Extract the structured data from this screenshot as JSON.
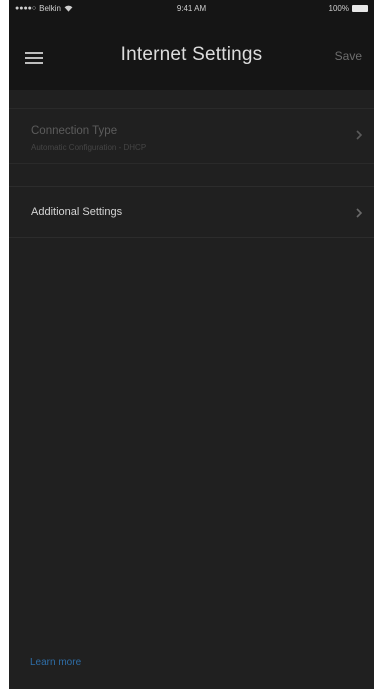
{
  "status_bar": {
    "carrier": "Belkin",
    "time": "9:41 AM",
    "battery": "100%"
  },
  "header": {
    "title": "Internet Settings",
    "save_label": "Save",
    "menu_icon": "hamburger-menu-icon"
  },
  "settings": {
    "connection_type": {
      "label": "Connection Type",
      "value": "Automatic Configuration - DHCP",
      "icon": "chevron-right-icon"
    },
    "additional_settings": {
      "label": "Additional Settings",
      "icon": "chevron-right-icon"
    }
  },
  "footer": {
    "learn_more": "Learn more"
  },
  "colors": {
    "background": "#202020",
    "header": "#151515",
    "link": "#2e6da6"
  }
}
